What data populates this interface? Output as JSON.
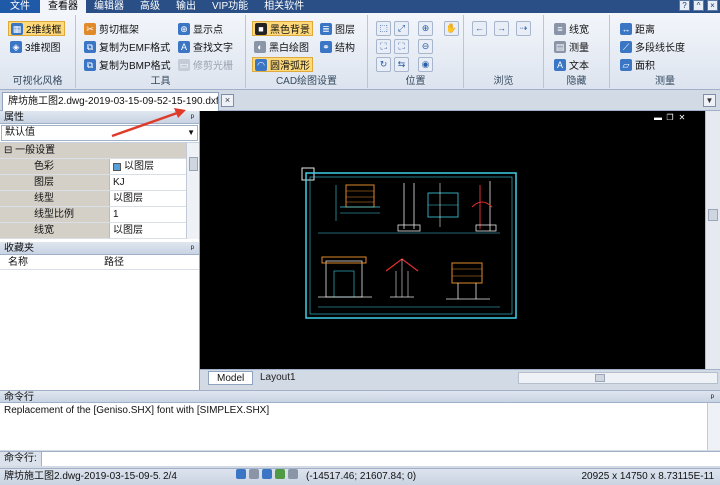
{
  "menu": {
    "items": [
      "文件",
      "查看器",
      "编辑器",
      "高级",
      "输出",
      "VIP功能",
      "相关软件"
    ],
    "active_index": 1,
    "window_buttons": [
      "?",
      "^",
      "×"
    ]
  },
  "ribbon": {
    "groups": [
      {
        "label": "可视化风格",
        "buttons": [
          "2维线框",
          "3维视图"
        ]
      },
      {
        "label": "工具",
        "buttons": [
          "剪切框架",
          "复制为EMF格式",
          "复制为BMP格式",
          "显示点",
          "查找文字",
          "修剪光栅"
        ]
      },
      {
        "label": "CAD绘图设置",
        "buttons": [
          "黑色背景",
          "黑白绘图",
          "圆滑弧形",
          "图层",
          "结构"
        ]
      },
      {
        "label": "位置",
        "buttons": []
      },
      {
        "label": "浏览",
        "buttons": []
      },
      {
        "label": "隐藏",
        "buttons": [
          "线宽",
          "测量",
          "文本"
        ]
      },
      {
        "label": "测量",
        "buttons": [
          "距离",
          "多段线长度",
          "面积"
        ]
      }
    ]
  },
  "document_tab": {
    "title": "牌坊施工图2.dwg-2019-03-15-09-52-15-190.dxf",
    "close_glyph": "×",
    "menu_glyph": "▼"
  },
  "properties_panel": {
    "title": "属性",
    "pin_glyph": "ᵖ",
    "selector_value": "默认值",
    "category": "一般设置",
    "rows": [
      {
        "key": "色彩",
        "value": "以图层",
        "swatch": "#5aa0d8"
      },
      {
        "key": "图层",
        "value": "KJ"
      },
      {
        "key": "线型",
        "value": "以图层"
      },
      {
        "key": "线型比例",
        "value": "1"
      },
      {
        "key": "线宽",
        "value": "以图层"
      }
    ]
  },
  "favorites_panel": {
    "title": "收藏夹",
    "columns": [
      "名称",
      "路径"
    ]
  },
  "layout_tabs": [
    "Model",
    "Layout1"
  ],
  "command": {
    "title": "命令行",
    "output": "Replacement of the [Geniso.SHX] font with [SIMPLEX.SHX]",
    "input_label": "命令行:",
    "input_value": ""
  },
  "status_bar": {
    "file": "牌坊施工图2.dwg-2019-03-15-09-5...",
    "page": "2/4",
    "coords": "(-14517.46; 21607.84; 0)",
    "size": "20925 x 14750 x 8.73115E-11"
  },
  "colors": {
    "menu_bg": "#2a4f86",
    "canvas_bg": "#000000",
    "drawing_frame": "#3fd0e8",
    "drawing_red": "#e03030",
    "drawing_white": "#e8e8e8",
    "annotation_arrow": "#e03a2a"
  }
}
